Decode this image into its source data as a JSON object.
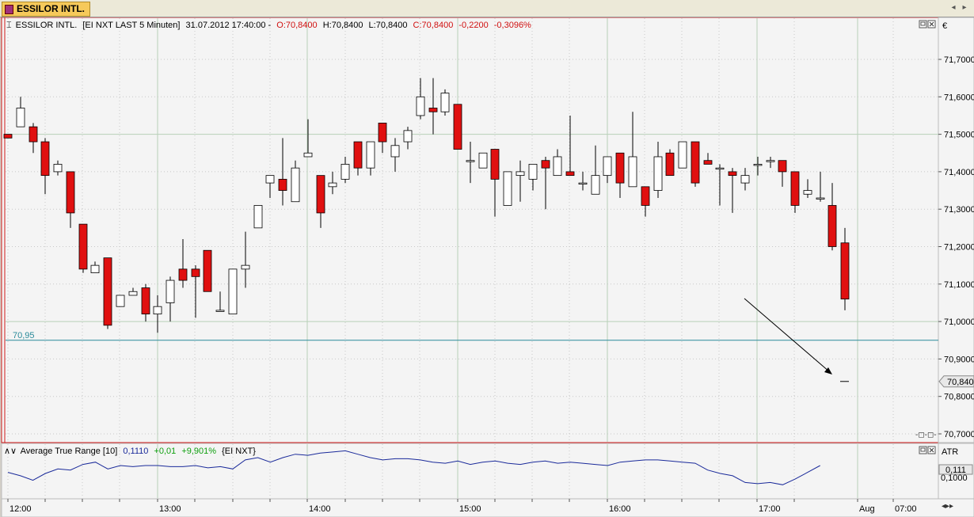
{
  "tab": {
    "label": "ESSILOR INTL."
  },
  "header": {
    "icon": "candlestick-icon",
    "symbol": "ESSILOR INTL.",
    "source": "[EI NXT LAST 5 Minuten]",
    "datetime": "31.07.2012 17:40:00",
    "open": "O:70,8400",
    "high": "H:70,8400",
    "low": "L:70,8400",
    "close": "C:70,8400",
    "change": "-0,2200",
    "change_pct": "-0,3096%",
    "currency": "€"
  },
  "atr_header": {
    "label": "Average True Range [10]",
    "value": "0,1110",
    "change": "+0,01",
    "change_pct": "+9,901%",
    "source": "{EI NXT}",
    "axis_label": "ATR",
    "axis_value": "0,111",
    "axis_tick": "0,1000"
  },
  "colors": {
    "up": "#ffffff",
    "down": "#e01010",
    "atr_line": "#1a2a9a",
    "hline": "#2a8a9a",
    "change_neg": "#d01010",
    "change_pos": "#10a010"
  },
  "chart_data": {
    "type": "candlestick",
    "y_ticks": [
      "71,7000",
      "71,6000",
      "71,5000",
      "71,4000",
      "71,3000",
      "71,2000",
      "71,1000",
      "71,0000",
      "70,9000",
      "70,8000",
      "70,7000"
    ],
    "ylim": [
      70.69,
      71.77
    ],
    "x_ticks": [
      "12:00",
      "13:00",
      "14:00",
      "15:00",
      "16:00",
      "17:00",
      "Aug",
      "07:00"
    ],
    "hline": {
      "value": 70.95,
      "label": "70,95"
    },
    "last_price_label": "70,840",
    "last_price": 70.84,
    "candles": [
      {
        "o": 71.5,
        "h": 71.5,
        "l": 71.49,
        "c": 71.49
      },
      {
        "o": 71.52,
        "h": 71.6,
        "l": 71.52,
        "c": 71.57
      },
      {
        "o": 71.52,
        "h": 71.53,
        "l": 71.45,
        "c": 71.48
      },
      {
        "o": 71.48,
        "h": 71.49,
        "l": 71.34,
        "c": 71.39
      },
      {
        "o": 71.4,
        "h": 71.43,
        "l": 71.39,
        "c": 71.42
      },
      {
        "o": 71.4,
        "h": 71.4,
        "l": 71.25,
        "c": 71.29
      },
      {
        "o": 71.26,
        "h": 71.26,
        "l": 71.13,
        "c": 71.14
      },
      {
        "o": 71.13,
        "h": 71.16,
        "l": 71.13,
        "c": 71.15
      },
      {
        "o": 71.17,
        "h": 71.17,
        "l": 70.98,
        "c": 70.99
      },
      {
        "o": 71.04,
        "h": 71.07,
        "l": 71.04,
        "c": 71.07
      },
      {
        "o": 71.07,
        "h": 71.09,
        "l": 71.07,
        "c": 71.08
      },
      {
        "o": 71.09,
        "h": 71.1,
        "l": 71.0,
        "c": 71.02
      },
      {
        "o": 71.02,
        "h": 71.07,
        "l": 70.97,
        "c": 71.04
      },
      {
        "o": 71.05,
        "h": 71.12,
        "l": 71.0,
        "c": 71.11
      },
      {
        "o": 71.14,
        "h": 71.22,
        "l": 71.09,
        "c": 71.11
      },
      {
        "o": 71.14,
        "h": 71.15,
        "l": 71.01,
        "c": 71.12
      },
      {
        "o": 71.19,
        "h": 71.19,
        "l": 71.08,
        "c": 71.08
      },
      {
        "o": 71.03,
        "h": 71.08,
        "l": 71.03,
        "c": 71.03
      },
      {
        "o": 71.02,
        "h": 71.14,
        "l": 71.02,
        "c": 71.14
      },
      {
        "o": 71.14,
        "h": 71.24,
        "l": 71.09,
        "c": 71.15
      },
      {
        "o": 71.25,
        "h": 71.31,
        "l": 71.25,
        "c": 71.31
      },
      {
        "o": 71.37,
        "h": 71.39,
        "l": 71.33,
        "c": 71.39
      },
      {
        "o": 71.38,
        "h": 71.49,
        "l": 71.31,
        "c": 71.35
      },
      {
        "o": 71.32,
        "h": 71.43,
        "l": 71.32,
        "c": 71.41
      },
      {
        "o": 71.44,
        "h": 71.54,
        "l": 71.44,
        "c": 71.45
      },
      {
        "o": 71.39,
        "h": 71.39,
        "l": 71.25,
        "c": 71.29
      },
      {
        "o": 71.36,
        "h": 71.4,
        "l": 71.34,
        "c": 71.37
      },
      {
        "o": 71.38,
        "h": 71.44,
        "l": 71.37,
        "c": 71.42
      },
      {
        "o": 71.48,
        "h": 71.48,
        "l": 71.39,
        "c": 71.41
      },
      {
        "o": 71.41,
        "h": 71.48,
        "l": 71.39,
        "c": 71.48
      },
      {
        "o": 71.53,
        "h": 71.53,
        "l": 71.45,
        "c": 71.48
      },
      {
        "o": 71.44,
        "h": 71.49,
        "l": 71.4,
        "c": 71.47
      },
      {
        "o": 71.48,
        "h": 71.52,
        "l": 71.46,
        "c": 71.51
      },
      {
        "o": 71.55,
        "h": 71.65,
        "l": 71.54,
        "c": 71.6
      },
      {
        "o": 71.57,
        "h": 71.65,
        "l": 71.5,
        "c": 71.56
      },
      {
        "o": 71.56,
        "h": 71.62,
        "l": 71.55,
        "c": 71.61
      },
      {
        "o": 71.58,
        "h": 71.58,
        "l": 71.46,
        "c": 71.46
      },
      {
        "o": 71.43,
        "h": 71.48,
        "l": 71.37,
        "c": 71.43
      },
      {
        "o": 71.41,
        "h": 71.45,
        "l": 71.41,
        "c": 71.45
      },
      {
        "o": 71.46,
        "h": 71.46,
        "l": 71.28,
        "c": 71.38
      },
      {
        "o": 71.31,
        "h": 71.4,
        "l": 71.31,
        "c": 71.4
      },
      {
        "o": 71.39,
        "h": 71.43,
        "l": 71.32,
        "c": 71.4
      },
      {
        "o": 71.38,
        "h": 71.42,
        "l": 71.35,
        "c": 71.42
      },
      {
        "o": 71.43,
        "h": 71.44,
        "l": 71.3,
        "c": 71.41
      },
      {
        "o": 71.39,
        "h": 71.46,
        "l": 71.39,
        "c": 71.44
      },
      {
        "o": 71.4,
        "h": 71.55,
        "l": 71.39,
        "c": 71.39
      },
      {
        "o": 71.37,
        "h": 71.4,
        "l": 71.35,
        "c": 71.37
      },
      {
        "o": 71.34,
        "h": 71.47,
        "l": 71.34,
        "c": 71.39
      },
      {
        "o": 71.39,
        "h": 71.43,
        "l": 71.37,
        "c": 71.44
      },
      {
        "o": 71.45,
        "h": 71.45,
        "l": 71.33,
        "c": 71.37
      },
      {
        "o": 71.36,
        "h": 71.56,
        "l": 71.36,
        "c": 71.44
      },
      {
        "o": 71.36,
        "h": 71.36,
        "l": 71.28,
        "c": 71.31
      },
      {
        "o": 71.35,
        "h": 71.48,
        "l": 71.33,
        "c": 71.44
      },
      {
        "o": 71.45,
        "h": 71.46,
        "l": 71.39,
        "c": 71.39
      },
      {
        "o": 71.41,
        "h": 71.47,
        "l": 71.41,
        "c": 71.48
      },
      {
        "o": 71.48,
        "h": 71.48,
        "l": 71.36,
        "c": 71.37
      },
      {
        "o": 71.43,
        "h": 71.45,
        "l": 71.42,
        "c": 71.42
      },
      {
        "o": 71.41,
        "h": 71.42,
        "l": 71.31,
        "c": 71.41
      },
      {
        "o": 71.4,
        "h": 71.41,
        "l": 71.29,
        "c": 71.39
      },
      {
        "o": 71.37,
        "h": 71.41,
        "l": 71.35,
        "c": 71.39
      },
      {
        "o": 71.42,
        "h": 71.44,
        "l": 71.39,
        "c": 71.42
      },
      {
        "o": 71.43,
        "h": 71.44,
        "l": 71.41,
        "c": 71.43
      },
      {
        "o": 71.43,
        "h": 71.43,
        "l": 71.36,
        "c": 71.4
      },
      {
        "o": 71.4,
        "h": 71.4,
        "l": 71.29,
        "c": 71.31
      },
      {
        "o": 71.34,
        "h": 71.38,
        "l": 71.33,
        "c": 71.35
      },
      {
        "o": 71.33,
        "h": 71.4,
        "l": 71.32,
        "c": 71.33
      },
      {
        "o": 71.31,
        "h": 71.37,
        "l": 71.19,
        "c": 71.2
      },
      {
        "o": 71.21,
        "h": 71.25,
        "l": 71.03,
        "c": 71.06
      }
    ],
    "atr_values": [
      0.105,
      0.102,
      0.098,
      0.104,
      0.108,
      0.107,
      0.112,
      0.114,
      0.108,
      0.111,
      0.11,
      0.111,
      0.111,
      0.11,
      0.11,
      0.111,
      0.109,
      0.11,
      0.108,
      0.116,
      0.118,
      0.114,
      0.118,
      0.121,
      0.12,
      0.122,
      0.123,
      0.124,
      0.121,
      0.118,
      0.116,
      0.117,
      0.117,
      0.116,
      0.114,
      0.113,
      0.115,
      0.112,
      0.114,
      0.115,
      0.113,
      0.112,
      0.114,
      0.115,
      0.113,
      0.114,
      0.113,
      0.112,
      0.111,
      0.114,
      0.115,
      0.116,
      0.116,
      0.115,
      0.114,
      0.113,
      0.107,
      0.104,
      0.102,
      0.096,
      0.095,
      0.096,
      0.094,
      0.099,
      0.105,
      0.111
    ]
  }
}
